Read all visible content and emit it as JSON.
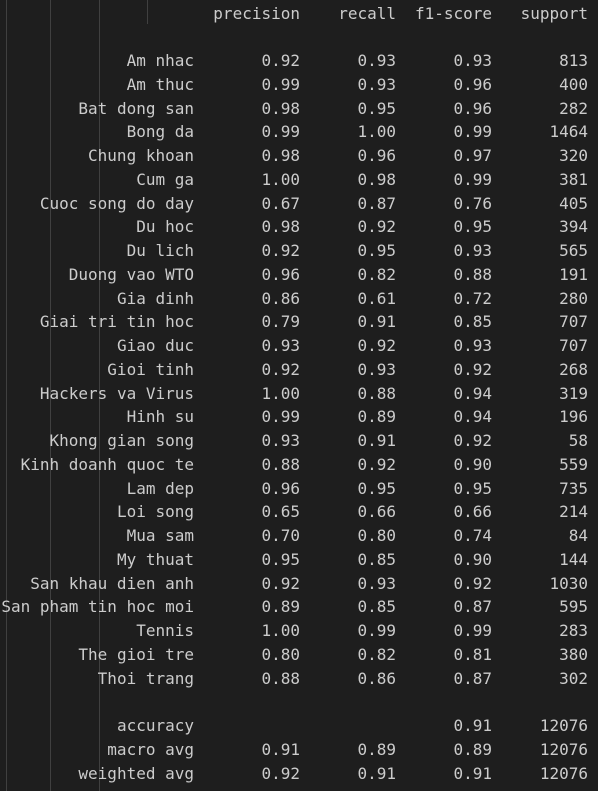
{
  "header": {
    "precision": "precision",
    "recall": "recall",
    "f1_score": "f1-score",
    "support": "support"
  },
  "rows": [
    {
      "label": "Am nhac",
      "precision": "0.92",
      "recall": "0.93",
      "f1": "0.93",
      "support": "813"
    },
    {
      "label": "Am thuc",
      "precision": "0.99",
      "recall": "0.93",
      "f1": "0.96",
      "support": "400"
    },
    {
      "label": "Bat dong san",
      "precision": "0.98",
      "recall": "0.95",
      "f1": "0.96",
      "support": "282"
    },
    {
      "label": "Bong da",
      "precision": "0.99",
      "recall": "1.00",
      "f1": "0.99",
      "support": "1464"
    },
    {
      "label": "Chung khoan",
      "precision": "0.98",
      "recall": "0.96",
      "f1": "0.97",
      "support": "320"
    },
    {
      "label": "Cum ga",
      "precision": "1.00",
      "recall": "0.98",
      "f1": "0.99",
      "support": "381"
    },
    {
      "label": "Cuoc song do day",
      "precision": "0.67",
      "recall": "0.87",
      "f1": "0.76",
      "support": "405"
    },
    {
      "label": "Du hoc",
      "precision": "0.98",
      "recall": "0.92",
      "f1": "0.95",
      "support": "394"
    },
    {
      "label": "Du lich",
      "precision": "0.92",
      "recall": "0.95",
      "f1": "0.93",
      "support": "565"
    },
    {
      "label": "Duong vao WTO",
      "precision": "0.96",
      "recall": "0.82",
      "f1": "0.88",
      "support": "191"
    },
    {
      "label": "Gia dinh",
      "precision": "0.86",
      "recall": "0.61",
      "f1": "0.72",
      "support": "280"
    },
    {
      "label": "Giai tri tin hoc",
      "precision": "0.79",
      "recall": "0.91",
      "f1": "0.85",
      "support": "707"
    },
    {
      "label": "Giao duc",
      "precision": "0.93",
      "recall": "0.92",
      "f1": "0.93",
      "support": "707"
    },
    {
      "label": "Gioi tinh",
      "precision": "0.92",
      "recall": "0.93",
      "f1": "0.92",
      "support": "268"
    },
    {
      "label": "Hackers va Virus",
      "precision": "1.00",
      "recall": "0.88",
      "f1": "0.94",
      "support": "319"
    },
    {
      "label": "Hinh su",
      "precision": "0.99",
      "recall": "0.89",
      "f1": "0.94",
      "support": "196"
    },
    {
      "label": "Khong gian song",
      "precision": "0.93",
      "recall": "0.91",
      "f1": "0.92",
      "support": "58"
    },
    {
      "label": "Kinh doanh quoc te",
      "precision": "0.88",
      "recall": "0.92",
      "f1": "0.90",
      "support": "559"
    },
    {
      "label": "Lam dep",
      "precision": "0.96",
      "recall": "0.95",
      "f1": "0.95",
      "support": "735"
    },
    {
      "label": "Loi song",
      "precision": "0.65",
      "recall": "0.66",
      "f1": "0.66",
      "support": "214"
    },
    {
      "label": "Mua sam",
      "precision": "0.70",
      "recall": "0.80",
      "f1": "0.74",
      "support": "84"
    },
    {
      "label": "My thuat",
      "precision": "0.95",
      "recall": "0.85",
      "f1": "0.90",
      "support": "144"
    },
    {
      "label": "San khau dien anh",
      "precision": "0.92",
      "recall": "0.93",
      "f1": "0.92",
      "support": "1030"
    },
    {
      "label": "San pham tin hoc moi",
      "precision": "0.89",
      "recall": "0.85",
      "f1": "0.87",
      "support": "595"
    },
    {
      "label": "Tennis",
      "precision": "1.00",
      "recall": "0.99",
      "f1": "0.99",
      "support": "283"
    },
    {
      "label": "The gioi tre",
      "precision": "0.80",
      "recall": "0.82",
      "f1": "0.81",
      "support": "380"
    },
    {
      "label": "Thoi trang",
      "precision": "0.88",
      "recall": "0.86",
      "f1": "0.87",
      "support": "302"
    }
  ],
  "summary": [
    {
      "label": "accuracy",
      "precision": "",
      "recall": "",
      "f1": "0.91",
      "support": "12076"
    },
    {
      "label": "macro avg",
      "precision": "0.91",
      "recall": "0.89",
      "f1": "0.89",
      "support": "12076"
    },
    {
      "label": "weighted avg",
      "precision": "0.92",
      "recall": "0.91",
      "f1": "0.91",
      "support": "12076"
    }
  ],
  "colors": {
    "background": "#1e1e1e",
    "text": "#cccccc",
    "indent_guide": "#404040"
  }
}
